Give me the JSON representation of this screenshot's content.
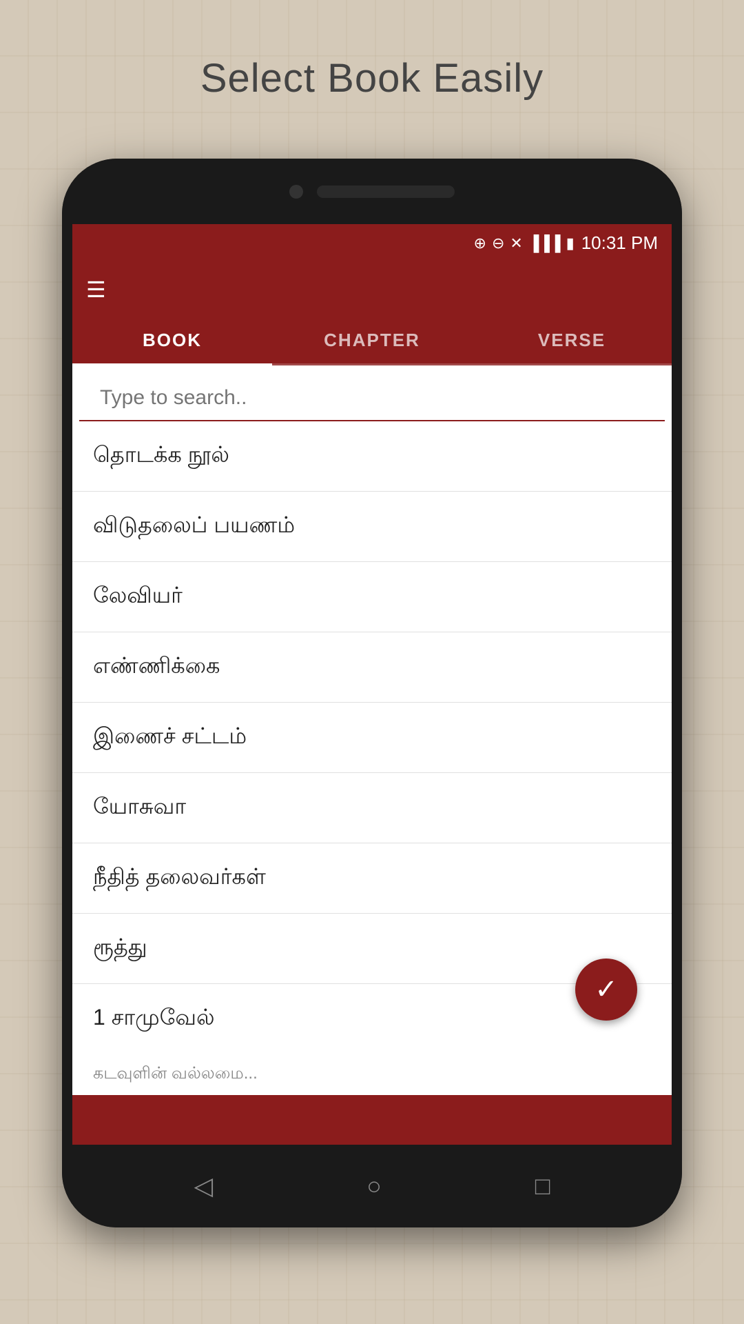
{
  "page": {
    "title": "Select Book Easily"
  },
  "status_bar": {
    "time": "10:31 PM",
    "icons": [
      "⊕",
      "⊖",
      "✕"
    ]
  },
  "tabs": [
    {
      "id": "book",
      "label": "BOOK",
      "active": true
    },
    {
      "id": "chapter",
      "label": "CHAPTER",
      "active": false
    },
    {
      "id": "verse",
      "label": "VERSE",
      "active": false
    }
  ],
  "search": {
    "placeholder": "Type to search.."
  },
  "list_items": [
    {
      "id": 1,
      "text": "தொடக்க நூல்"
    },
    {
      "id": 2,
      "text": "விடுதலைப் பயணம்"
    },
    {
      "id": 3,
      "text": "லேவியர்"
    },
    {
      "id": 4,
      "text": "எண்ணிக்கை"
    },
    {
      "id": 5,
      "text": "இணைச் சட்டம்"
    },
    {
      "id": 6,
      "text": "யோசுவா"
    },
    {
      "id": 7,
      "text": "நீதித் தலைவர்கள்"
    },
    {
      "id": 8,
      "text": "ரூத்து"
    },
    {
      "id": 9,
      "text": "1 சாமுவேல்"
    }
  ],
  "fab": {
    "icon": "✓"
  },
  "bottom_nav": {
    "back": "◁",
    "home": "○",
    "recent": "□"
  },
  "bottom_preview_text": "கடவுளின் வல்லமை..."
}
